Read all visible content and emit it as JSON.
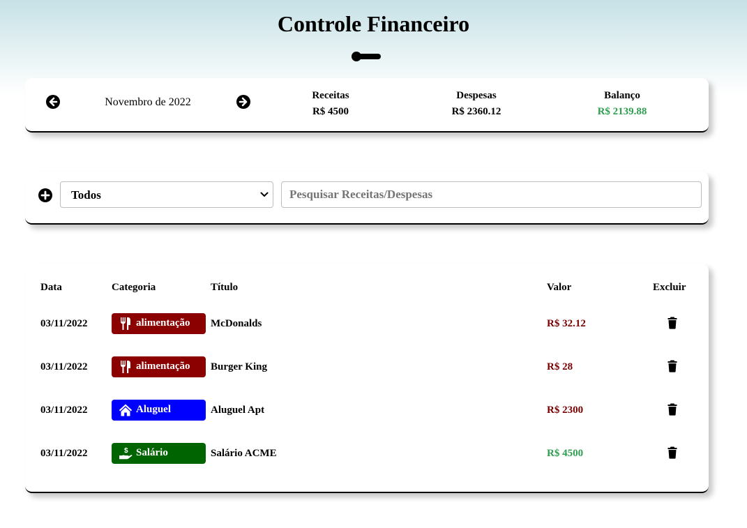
{
  "header": {
    "title": "Controle Financeiro"
  },
  "summary": {
    "month_label": "Novembro de 2022",
    "prev_icon": "arrow-left-circle-icon",
    "next_icon": "arrow-right-circle-icon",
    "receitas": {
      "label": "Receitas",
      "value": "R$ 4500"
    },
    "despesas": {
      "label": "Despesas",
      "value": "R$ 2360.12"
    },
    "balanco": {
      "label": "Balanço",
      "value": "R$ 2139.88",
      "color": "#2f9e4f"
    }
  },
  "filter": {
    "add_icon": "plus-circle-icon",
    "select_value": "Todos",
    "search_placeholder": "Pesquisar Receitas/Despesas",
    "search_value": ""
  },
  "table": {
    "columns": {
      "date": "Data",
      "category": "Categoria",
      "title": "Título",
      "value": "Valor",
      "delete": "Excluir"
    },
    "rows": [
      {
        "date": "03/11/2022",
        "category": "alimentação",
        "category_icon": "utensils-icon",
        "category_color": "#8b0000",
        "title": "McDonalds",
        "value": "R$ 32.12",
        "value_color": "#7a0000"
      },
      {
        "date": "03/11/2022",
        "category": "alimentação",
        "category_icon": "utensils-icon",
        "category_color": "#8b0000",
        "title": "Burger King",
        "value": "R$ 28",
        "value_color": "#7a0000"
      },
      {
        "date": "03/11/2022",
        "category": "Aluguel",
        "category_icon": "house-icon",
        "category_color": "#0000ff",
        "title": "Aluguel Apt",
        "value": "R$ 2300",
        "value_color": "#7a0000"
      },
      {
        "date": "03/11/2022",
        "category": "Salário",
        "category_icon": "hand-dollar-icon",
        "category_color": "#006400",
        "title": "Salário ACME",
        "value": "R$ 4500",
        "value_color": "#2f9e4f"
      }
    ]
  }
}
